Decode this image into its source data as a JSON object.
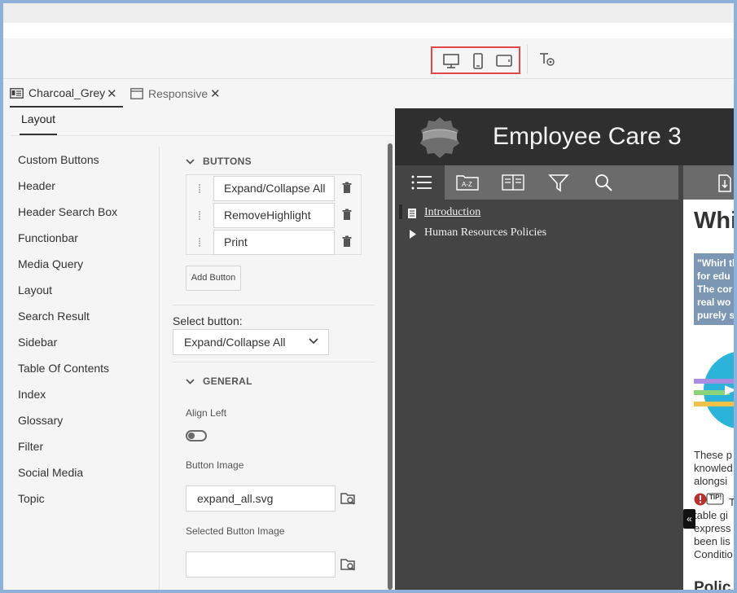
{
  "tabs": [
    {
      "label": "Charcoal_Grey",
      "active": true
    },
    {
      "label": "Responsive",
      "active": false
    }
  ],
  "panel": {
    "layout_tab": "Layout",
    "nav_items": [
      "Custom Buttons",
      "Header",
      "Header Search Box",
      "Functionbar",
      "Media Query",
      "Layout",
      "Search Result",
      "Sidebar",
      "Table Of Contents",
      "Index",
      "Glossary",
      "Filter",
      "Social Media",
      "Topic"
    ]
  },
  "buttons_section": {
    "title": "BUTTONS",
    "items": [
      "Expand/Collapse All",
      "RemoveHighlight",
      "Print"
    ],
    "add_label": "Add Button"
  },
  "select_button": {
    "label": "Select button:",
    "value": "Expand/Collapse All"
  },
  "general": {
    "title": "GENERAL",
    "align_left_label": "Align Left",
    "align_left_on": false,
    "button_image_label": "Button Image",
    "button_image_value": "expand_all.svg",
    "selected_image_label": "Selected Button Image",
    "selected_image_value": ""
  },
  "preview": {
    "title": "Employee Care 3",
    "toc": [
      "Introduction",
      "Human Resources Policies"
    ],
    "heading": "Whi",
    "quote_lines": [
      "\"Whirl th",
      "for edu",
      "The cor",
      "real wo",
      "purely s"
    ],
    "para1": [
      "These p",
      "knowled",
      "alongsi"
    ],
    "tip_label": "TIP!",
    "tip_first": "T",
    "para2": [
      "table gi",
      "express",
      "been lis",
      "Conditio"
    ],
    "heading2": "Polic",
    "collapse_glyph": "«",
    "accent": "#e0464a"
  }
}
